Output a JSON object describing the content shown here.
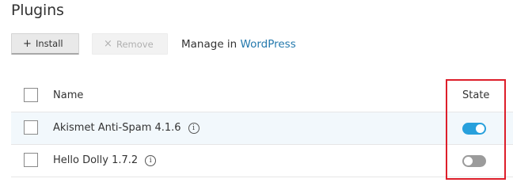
{
  "page": {
    "title": "Plugins"
  },
  "toolbar": {
    "install_label": "Install",
    "install_icon": "plus-icon",
    "remove_label": "Remove",
    "remove_icon": "x-icon",
    "manage_prefix": "Manage in ",
    "manage_link": "WordPress"
  },
  "table": {
    "columns": {
      "name": "Name",
      "state": "State"
    },
    "rows": [
      {
        "name": "Akismet Anti-Spam 4.1.6",
        "state": "on",
        "highlighted": true
      },
      {
        "name": "Hello Dolly 1.7.2",
        "state": "off",
        "highlighted": false
      }
    ]
  },
  "colors": {
    "link": "#2479ad",
    "toggle_on": "#28a0dc",
    "toggle_off": "#9b9b9b",
    "annotation_box": "#dd1e2a",
    "row_highlight": "#f2f8fc"
  }
}
